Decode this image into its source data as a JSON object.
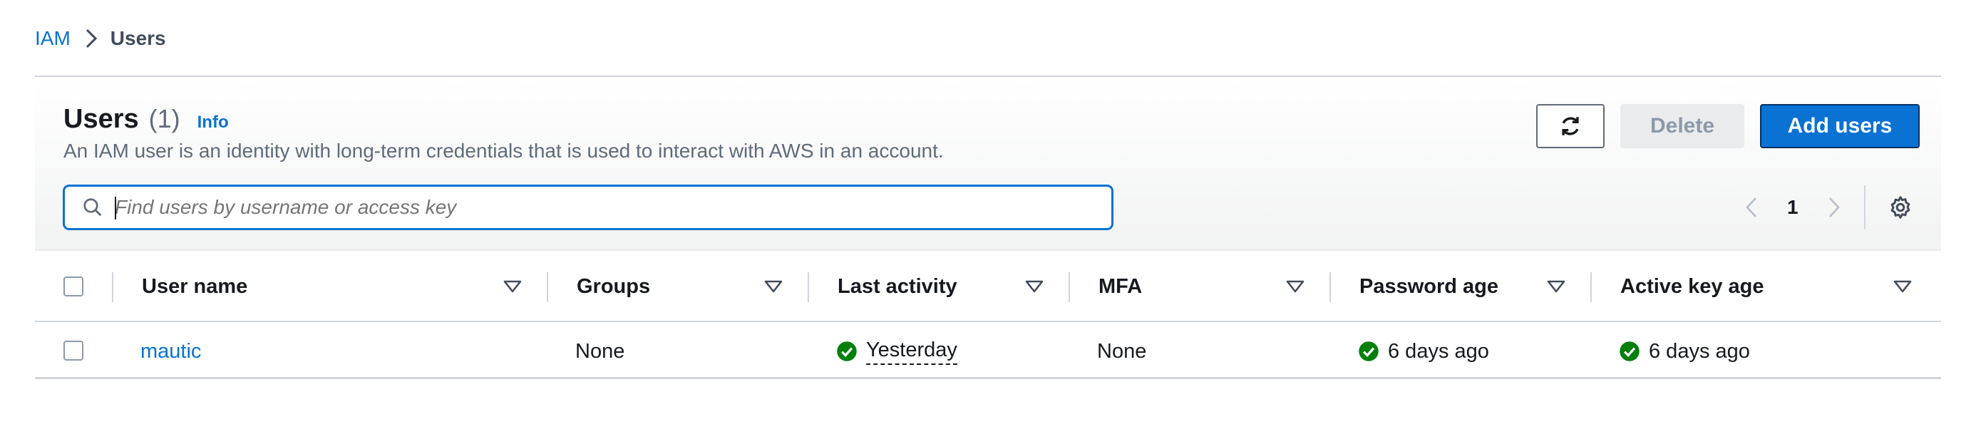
{
  "breadcrumb": {
    "root": "IAM",
    "current": "Users"
  },
  "header": {
    "title": "Users",
    "count": "(1)",
    "info": "Info",
    "description": "An IAM user is an identity with long-term credentials that is used to interact with AWS in an account."
  },
  "buttons": {
    "refresh_icon": "refresh-icon",
    "delete": "Delete",
    "add": "Add users"
  },
  "search": {
    "placeholder": "Find users by username or access key",
    "value": ""
  },
  "pagination": {
    "page": "1"
  },
  "colors": {
    "accent": "#0972d3",
    "success": "#037f0c",
    "muted": "#5f6b7a"
  },
  "table": {
    "columns": [
      "User name",
      "Groups",
      "Last activity",
      "MFA",
      "Password age",
      "Active key age"
    ],
    "rows": [
      {
        "user_name": "mautic",
        "groups": "None",
        "last_activity": "Yesterday",
        "mfa": "None",
        "password_age": "6 days ago",
        "active_key_age": "6 days ago"
      }
    ]
  }
}
